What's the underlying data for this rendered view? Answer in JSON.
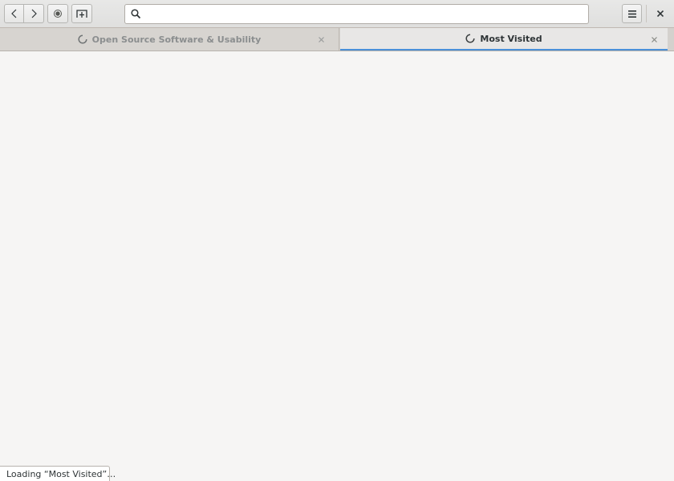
{
  "toolbar": {
    "back_icon": "chevron-left-icon",
    "forward_icon": "chevron-right-icon",
    "record_icon": "record-icon",
    "new_tab_icon": "new-tab-icon",
    "menu_icon": "hamburger-menu-icon",
    "close_icon": "close-icon"
  },
  "urlbar": {
    "value": "",
    "placeholder": "",
    "icon": "search-icon"
  },
  "tabs": [
    {
      "title": "Open Source Software & Usability",
      "state": "loading",
      "active": false
    },
    {
      "title": "Most Visited",
      "state": "loading",
      "active": true
    }
  ],
  "status": {
    "text": "Loading “Most Visited”…"
  },
  "colors": {
    "accent": "#4a90d9",
    "background": "#f6f5f4",
    "headerbar": "#e3e3e2"
  }
}
